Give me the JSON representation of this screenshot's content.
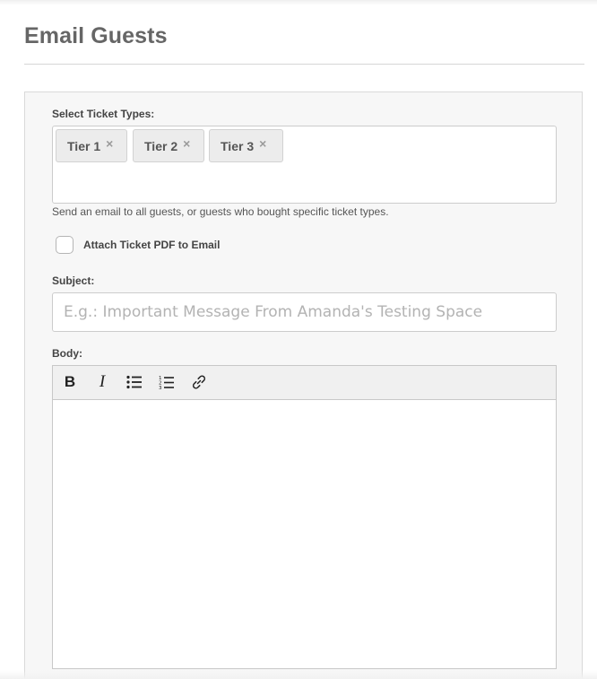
{
  "page": {
    "title": "Email Guests"
  },
  "ticket_types": {
    "label": "Select Ticket Types:",
    "selected": [
      {
        "label": "Tier 1",
        "remove_symbol": "×"
      },
      {
        "label": "Tier 2",
        "remove_symbol": "×"
      },
      {
        "label": "Tier 3",
        "remove_symbol": "×"
      }
    ],
    "help_text": "Send an email to all guests, or guests who bought specific ticket types."
  },
  "attach_pdf": {
    "label": "Attach Ticket PDF to Email",
    "checked": false
  },
  "subject": {
    "label": "Subject:",
    "value": "",
    "placeholder": "E.g.: Important Message From Amanda's Testing Space"
  },
  "body": {
    "label": "Body:",
    "toolbar": {
      "bold_glyph": "B",
      "italic_glyph": "I",
      "bullet_list_icon": "bullet-list-icon",
      "numbered_list_icon": "numbered-list-icon",
      "link_icon": "link-icon"
    },
    "content": ""
  }
}
